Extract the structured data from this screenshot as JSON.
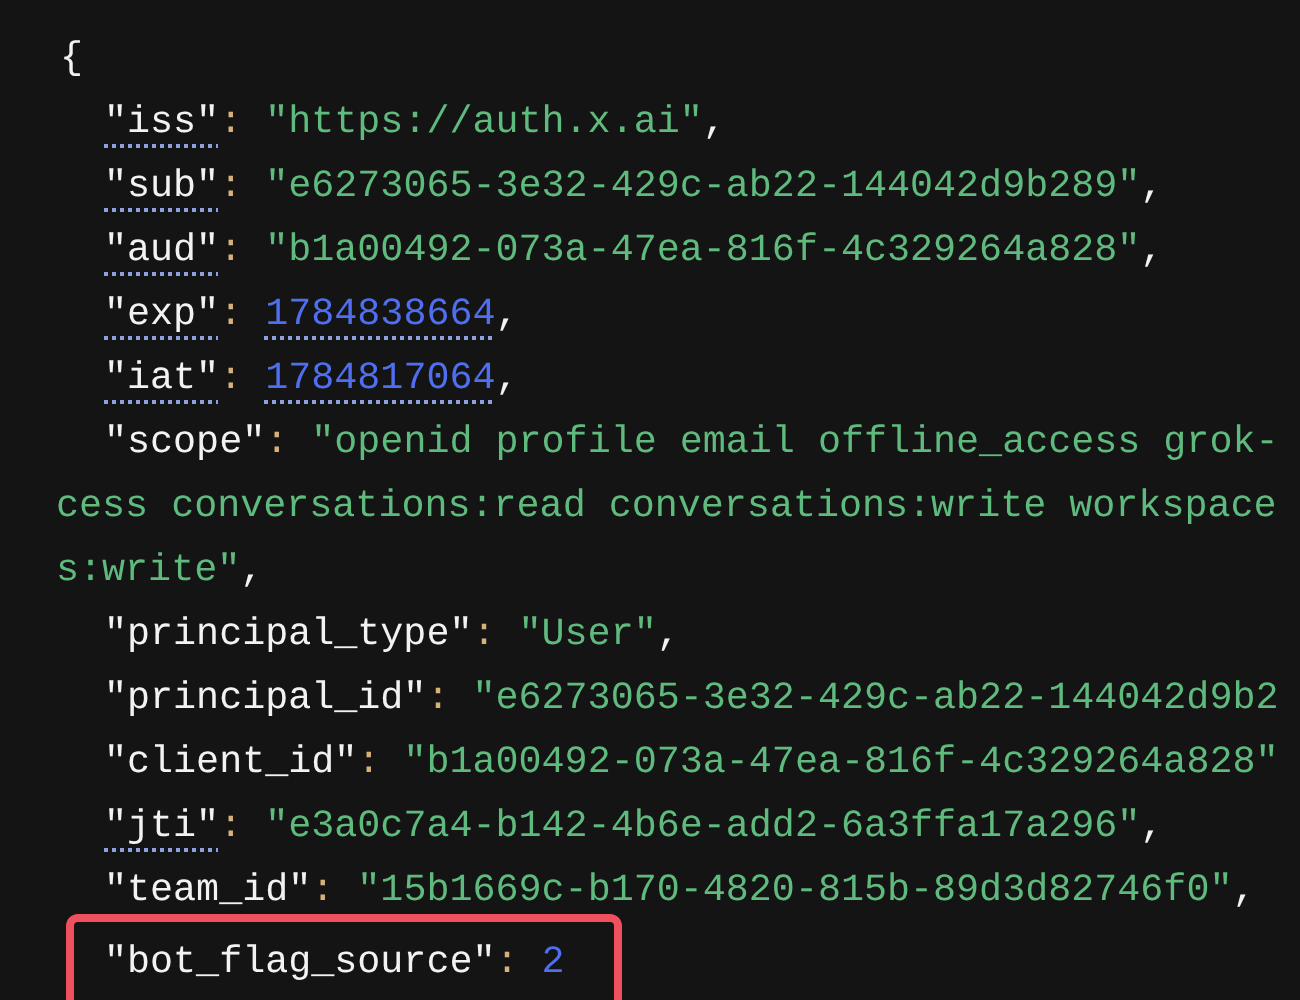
{
  "code_view": {
    "lines": [
      {
        "kind": "brace",
        "text": "{"
      },
      {
        "kind": "pair",
        "key": {
          "text": "\"iss\"",
          "underlined": true
        },
        "colon": ":",
        "value": {
          "kind": "string",
          "text": "\"https://auth.x.ai\"",
          "underlined": false
        },
        "comma": ","
      },
      {
        "kind": "pair",
        "key": {
          "text": "\"sub\"",
          "underlined": true
        },
        "colon": ":",
        "value": {
          "kind": "string",
          "text": "\"e6273065-3e32-429c-ab22-144042d9b289\"",
          "underlined": false
        },
        "comma": ","
      },
      {
        "kind": "pair",
        "key": {
          "text": "\"aud\"",
          "underlined": true
        },
        "colon": ":",
        "value": {
          "kind": "string",
          "text": "\"b1a00492-073a-47ea-816f-4c329264a828\"",
          "underlined": false
        },
        "comma": ","
      },
      {
        "kind": "pair",
        "key": {
          "text": "\"exp\"",
          "underlined": true
        },
        "colon": ":",
        "value": {
          "kind": "number",
          "text": "1784838664",
          "underlined": true
        },
        "comma": ","
      },
      {
        "kind": "pair",
        "key": {
          "text": "\"iat\"",
          "underlined": true
        },
        "colon": ":",
        "value": {
          "kind": "number",
          "text": "1784817064",
          "underlined": true
        },
        "comma": ","
      },
      {
        "kind": "pair",
        "key": {
          "text": "\"scope\"",
          "underlined": false
        },
        "colon": ":",
        "value": {
          "kind": "string",
          "text": "\"openid profile email offline_access grok-",
          "underlined": false
        }
      },
      {
        "kind": "continuation",
        "value": {
          "kind": "string",
          "text": "cess conversations:read conversations:write workspace"
        }
      },
      {
        "kind": "continuation",
        "value": {
          "kind": "string",
          "text": "s:write\""
        },
        "comma": ","
      },
      {
        "kind": "pair",
        "key": {
          "text": "\"principal_type\"",
          "underlined": false
        },
        "colon": ":",
        "value": {
          "kind": "string",
          "text": "\"User\"",
          "underlined": false
        },
        "comma": ","
      },
      {
        "kind": "pair",
        "key": {
          "text": "\"principal_id\"",
          "underlined": false
        },
        "colon": ":",
        "value": {
          "kind": "string",
          "text": "\"e6273065-3e32-429c-ab22-144042d9b2",
          "underlined": false
        }
      },
      {
        "kind": "pair",
        "key": {
          "text": "\"client_id\"",
          "underlined": false
        },
        "colon": ":",
        "value": {
          "kind": "string",
          "text": "\"b1a00492-073a-47ea-816f-4c329264a828\"",
          "underlined": false
        }
      },
      {
        "kind": "pair",
        "key": {
          "text": "\"jti\"",
          "underlined": true
        },
        "colon": ":",
        "value": {
          "kind": "string",
          "text": "\"e3a0c7a4-b142-4b6e-add2-6a3ffa17a296\"",
          "underlined": false
        },
        "comma": ","
      },
      {
        "kind": "pair",
        "key": {
          "text": "\"team_id\"",
          "underlined": false
        },
        "colon": ":",
        "value": {
          "kind": "string",
          "text": "\"15b1669c-b170-4820-815b-89d3d82746f0\"",
          "underlined": false
        },
        "comma": ","
      },
      {
        "kind": "highlighted_pair",
        "key": {
          "text": "\"bot_flag_source\"",
          "underlined": false
        },
        "colon": ":",
        "value": {
          "kind": "number",
          "text": "2",
          "underlined": false
        }
      }
    ]
  }
}
